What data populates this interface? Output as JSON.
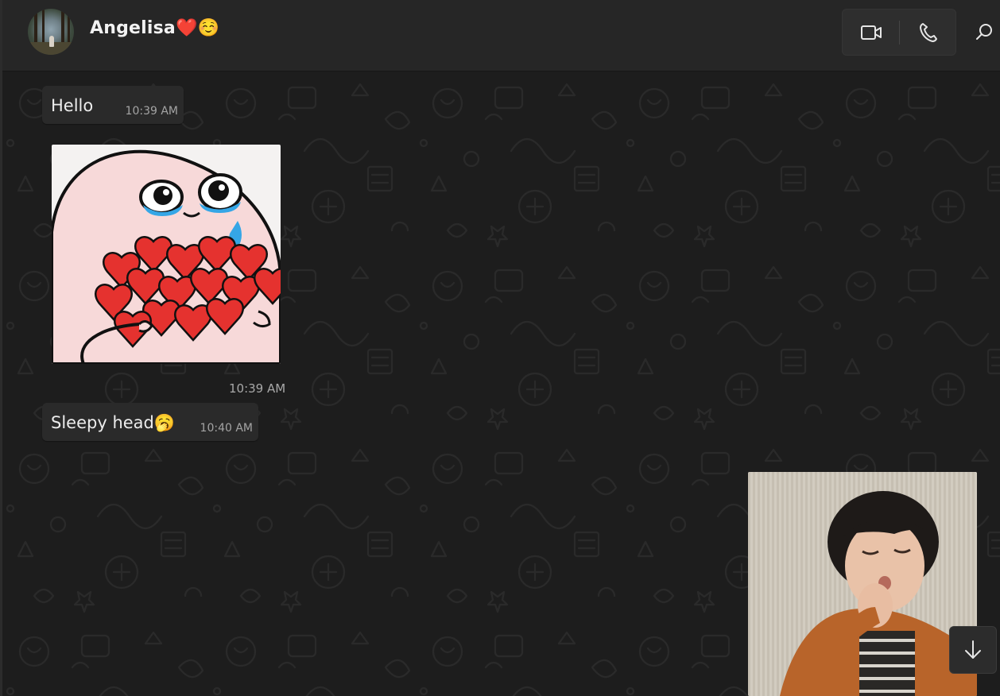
{
  "header": {
    "contact_name": "Angelisa❤️☺️",
    "video_call_icon": "video-camera-icon",
    "voice_call_icon": "phone-icon",
    "search_icon": "search-icon"
  },
  "messages": [
    {
      "type": "text",
      "text": "Hello",
      "time": "10:39 AM"
    },
    {
      "type": "sticker",
      "subject": "crying blob hugging hearts",
      "time": "10:39 AM"
    },
    {
      "type": "text",
      "text": "Sleepy head🥱",
      "time": "10:40 AM"
    },
    {
      "type": "image",
      "subject": "sleepy baby yawning"
    }
  ],
  "controls": {
    "scroll_down_icon": "arrow-down-icon"
  },
  "colors": {
    "header_bg": "#262626",
    "chat_bg": "#1d1d1d",
    "bubble_bg": "#2a2a2a",
    "text": "#ececec",
    "time": "#a4a4a4"
  }
}
